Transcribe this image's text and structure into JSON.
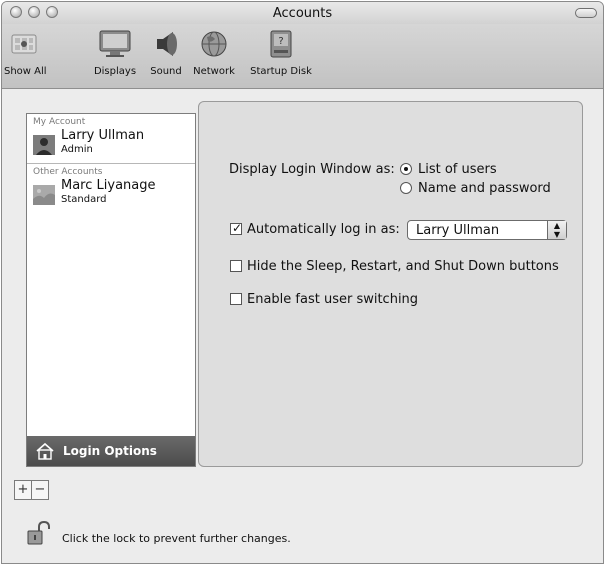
{
  "window": {
    "title": "Accounts"
  },
  "toolbar": {
    "items": [
      {
        "label": "Show All",
        "icon": "apple-grid-icon"
      },
      {
        "label": "Displays",
        "icon": "display-icon"
      },
      {
        "label": "Sound",
        "icon": "speaker-icon"
      },
      {
        "label": "Network",
        "icon": "globe-icon"
      },
      {
        "label": "Startup Disk",
        "icon": "hard-disk-icon"
      }
    ]
  },
  "accounts": {
    "my_header": "My Account",
    "my_account": {
      "name": "Larry Ullman",
      "role": "Admin"
    },
    "other_header": "Other Accounts",
    "other_accounts": [
      {
        "name": "Marc Liyanage",
        "role": "Standard"
      }
    ],
    "login_options_label": "Login Options",
    "add_label": "+",
    "remove_label": "−"
  },
  "login_options": {
    "display_label": "Display Login Window as:",
    "radio_list": "List of users",
    "radio_name": "Name and password",
    "display_selected": "List of users",
    "auto_login_label": "Automatically log in as:",
    "auto_login_checked": true,
    "auto_login_user": "Larry Ullman",
    "hide_buttons_label": "Hide the Sleep, Restart, and Shut Down buttons",
    "hide_buttons_checked": false,
    "fast_switch_label": "Enable fast user switching",
    "fast_switch_checked": false
  },
  "lock": {
    "text": "Click the lock to prevent further changes."
  }
}
